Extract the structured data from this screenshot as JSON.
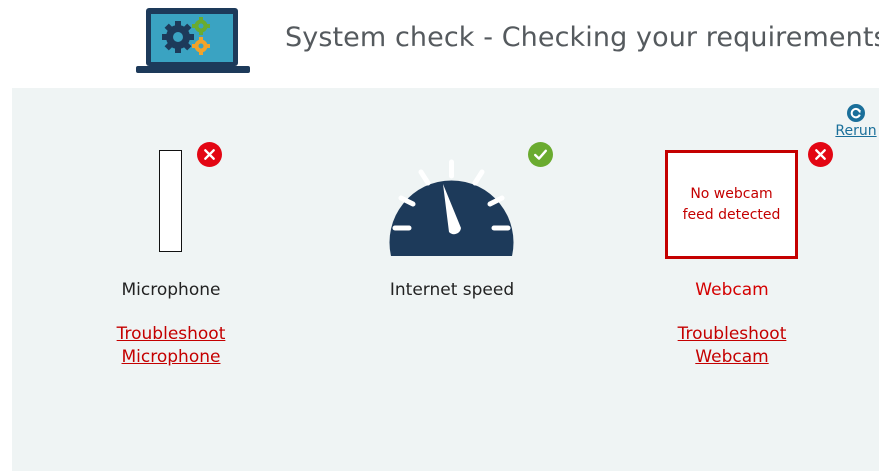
{
  "header": {
    "title": "System check - Checking your requirements",
    "icon": "laptop-gears-icon"
  },
  "toolbar": {
    "rerun_label": "Rerun",
    "rerun_icon": "refresh-icon"
  },
  "checks": {
    "microphone": {
      "label": "Microphone",
      "status": "fail",
      "status_icon": "x-circle-icon",
      "troubleshoot_line1": "Troubleshoot",
      "troubleshoot_line2": "Microphone"
    },
    "internet": {
      "label": "Internet speed",
      "status": "pass",
      "status_icon": "check-circle-icon",
      "gauge_icon": "speedometer-icon"
    },
    "webcam": {
      "label": "Webcam",
      "status": "fail",
      "status_icon": "x-circle-icon",
      "feed_message": "No webcam feed detected",
      "troubleshoot_line1": "Troubleshoot",
      "troubleshoot_line2": "Webcam"
    }
  },
  "colors": {
    "panel_bg": "#eff4f4",
    "error_red": "#d40000",
    "success_green": "#6aab2f",
    "gauge_navy": "#1d3a5a",
    "link_blue": "#1a6f9a"
  }
}
